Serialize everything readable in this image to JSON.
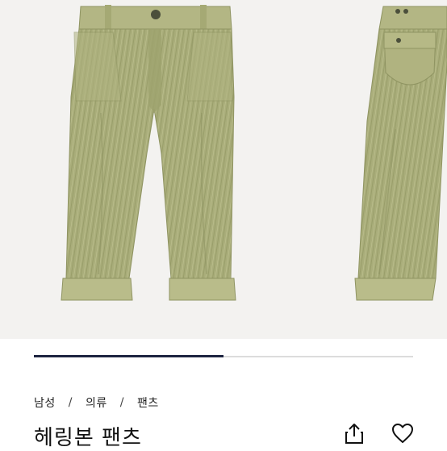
{
  "product": {
    "breadcrumb": [
      "남성",
      "의류",
      "팬츠"
    ],
    "separator": "/",
    "title": "헤링본 팬츠"
  },
  "gallery": {
    "progress": 0.5,
    "colors": {
      "background": "#f3f2f0",
      "fabric": "#a9ad7a",
      "fabric_shadow": "#8f9462",
      "fabric_light": "#c2c695"
    }
  },
  "actions": {
    "share_icon": "share-icon",
    "like_icon": "heart-icon"
  },
  "colors": {
    "progress_fill": "#1d2440",
    "progress_track": "#dcdcdc"
  }
}
